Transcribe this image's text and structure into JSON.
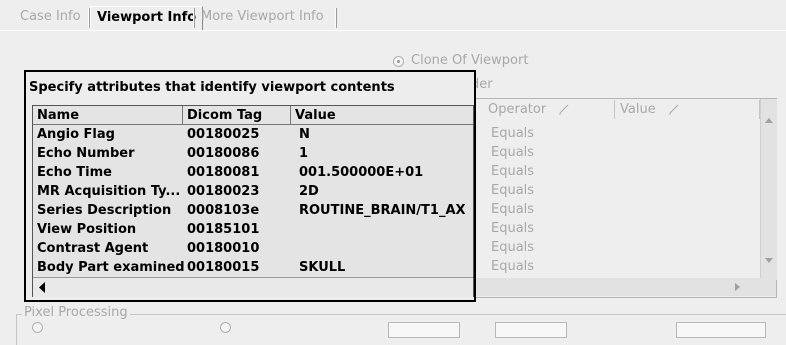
{
  "tabs": [
    {
      "label": "Case Info"
    },
    {
      "label": "Viewport Info"
    },
    {
      "label": "More Viewport Info"
    }
  ],
  "radios": {
    "clone_of_viewport": "Clone Of Viewport",
    "place_holder": "Place Holder"
  },
  "panel": {
    "title": "Specify attributes that identify viewport contents",
    "columns": [
      "Name",
      "Dicom Tag",
      "Value"
    ],
    "rows": [
      {
        "name": "Angio Flag",
        "tag": "00180025",
        "value": "N"
      },
      {
        "name": "Echo Number",
        "tag": "00180086",
        "value": "1"
      },
      {
        "name": "Echo Time",
        "tag": "00180081",
        "value": "001.500000E+01"
      },
      {
        "name": "MR Acquisition Ty...",
        "tag": "00180023",
        "value": "2D"
      },
      {
        "name": "Series Description",
        "tag": "0008103e",
        "value": "ROUTINE_BRAIN/T1_AX"
      },
      {
        "name": "View Position",
        "tag": "00185101",
        "value": ""
      },
      {
        "name": "Contrast Agent",
        "tag": "00180010",
        "value": ""
      },
      {
        "name": "Body Part examined",
        "tag": "00180015",
        "value": "SKULL"
      }
    ]
  },
  "background_table": {
    "operator_header": "Operator",
    "value_header": "Value",
    "operator_values": [
      "Equals",
      "Equals",
      "Equals",
      "Equals",
      "Equals",
      "Equals",
      "Equals",
      "Equals"
    ]
  },
  "pixel_processing": {
    "label": "Pixel Processing"
  }
}
